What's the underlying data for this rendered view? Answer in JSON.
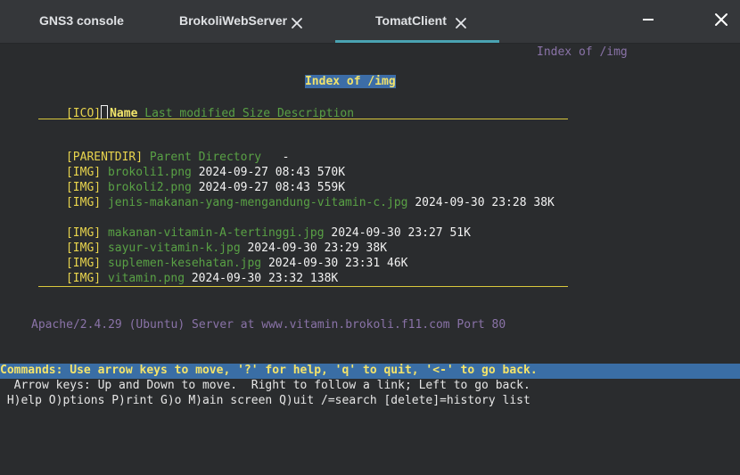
{
  "tabs": [
    {
      "label": "GNS3 console",
      "closable": false,
      "active": false
    },
    {
      "label": "BrokoliWebServer",
      "closable": true,
      "active": false
    },
    {
      "label": "TomatClient",
      "closable": true,
      "active": true
    }
  ],
  "window_controls": {
    "minimize_icon": "minimize-icon",
    "close_icon": "close-icon"
  },
  "terminal": {
    "corner_title": "Index of /img",
    "page_title": "Index of /img",
    "header": {
      "ico": "[ICO]",
      "name": "Name",
      "rest": " Last modified Size Description"
    },
    "parent": {
      "tag": "[PARENTDIR]",
      "link": "Parent Directory",
      "dash": "   -"
    },
    "files": [
      {
        "tag": "[IMG]",
        "name": "brokoli1.png",
        "date": "2024-09-27 08:43",
        "size": "570K"
      },
      {
        "tag": "[IMG]",
        "name": "brokoli2.png",
        "date": "2024-09-27 08:43",
        "size": "559K"
      },
      {
        "tag": "[IMG]",
        "name": "jenis-makanan-yang-mengandung-vitamin-c.jpg",
        "date": "2024-09-30 23:28",
        "size": "38K"
      },
      {
        "tag": "[IMG]",
        "name": "makanan-vitamin-A-tertinggi.jpg",
        "date": "2024-09-30 23:27",
        "size": "51K"
      },
      {
        "tag": "[IMG]",
        "name": "sayur-vitamin-k.jpg",
        "date": "2024-09-30 23:29",
        "size": "38K"
      },
      {
        "tag": "[IMG]",
        "name": "suplemen-kesehatan.jpg",
        "date": "2024-09-30 23:31",
        "size": "46K"
      },
      {
        "tag": "[IMG]",
        "name": "vitamin.png",
        "date": "2024-09-30 23:32",
        "size": "138K"
      }
    ],
    "server_line": "Apache/2.4.29 (Ubuntu) Server at www.vitamin.brokoli.f11.com Port 80",
    "status_line": "Commands: Use arrow keys to move, '?' for help, 'q' to quit, '<-' to go back.",
    "help_line_1": "  Arrow keys: Up and Down to move.  Right to follow a link; Left to go back.",
    "help_line_2": " H)elp O)ptions P)rint G)o M)ain screen Q)uit /=search [delete]=history list"
  },
  "colors": {
    "background": "#2a2c2e",
    "tabbar": "#35373a",
    "accent": "#4aa3b2",
    "link": "#59a145",
    "tag": "#e8d44d",
    "status_bar": "#3a6ea5"
  }
}
